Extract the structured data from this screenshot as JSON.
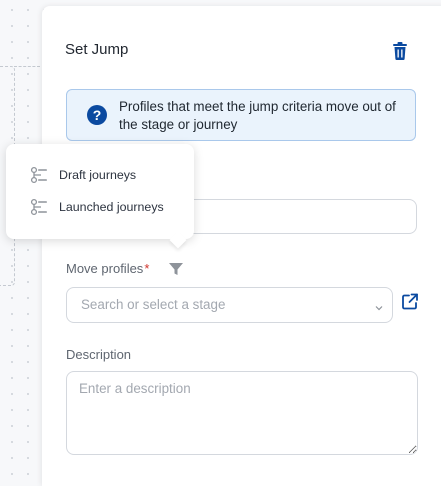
{
  "panel": {
    "title": "Set Jump",
    "info_text": "Profiles that meet the jump criteria move out of the stage or journey"
  },
  "move_profiles": {
    "label": "Move profiles",
    "required_mark": "*",
    "select_placeholder": "Search or select a stage"
  },
  "description": {
    "label": "Description",
    "placeholder": "Enter a description"
  },
  "popover": {
    "items": [
      {
        "label": "Draft journeys",
        "icon": "journey-icon"
      },
      {
        "label": "Launched journeys",
        "icon": "journey-icon"
      }
    ]
  },
  "colors": {
    "accent": "#0b4aa0",
    "info_bg": "#eaf3fc",
    "required": "#d0342c"
  }
}
